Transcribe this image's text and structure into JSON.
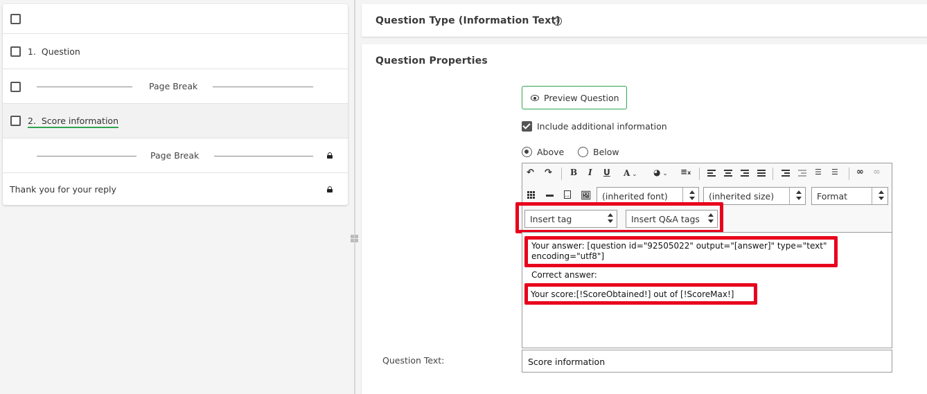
{
  "left_panel": {
    "rows": [
      {
        "type": "select-all",
        "label": ""
      },
      {
        "type": "question",
        "label": "1.  Question"
      },
      {
        "type": "page-break",
        "label": "Page Break"
      },
      {
        "type": "question",
        "label": "2.  Score information",
        "selected": true
      },
      {
        "type": "page-break",
        "label": "Page Break",
        "locked": true
      },
      {
        "type": "end",
        "label": "Thank you for your reply",
        "locked": true
      }
    ]
  },
  "header": {
    "question_type_title": "Question Type (Information Text)",
    "help_glyph": "?"
  },
  "properties": {
    "title": "Question Properties",
    "preview_button": "Preview Question",
    "include_additional_info": "Include additional information",
    "include_checked": true,
    "position_options": [
      "Above",
      "Below"
    ],
    "position_selected": "Above"
  },
  "editor": {
    "toolbar_icons": [
      "undo-icon",
      "redo-icon",
      "bold-icon",
      "italic-icon",
      "underline-icon",
      "text-color-icon",
      "background-color-icon",
      "clear-format-icon",
      "align-left-icon",
      "align-center-icon",
      "align-right-icon",
      "align-justify-icon",
      "indent-icon",
      "outdent-icon",
      "ordered-list-icon",
      "unordered-list-icon",
      "link-icon",
      "unlink-icon",
      "table-icon",
      "horizontal-rule-icon",
      "source-icon",
      "image-icon"
    ],
    "font_select": "(inherited font)",
    "size_select": "(inherited size)",
    "format_select": "Format",
    "insert_tag_select": "Insert tag",
    "insert_qa_tags_select": "Insert Q&A tags",
    "content": {
      "line1": "Your answer: [question id=\"92505022\" output=\"[answer]\" type=\"text\"",
      "line1b": "encoding=\"utf8\"]",
      "line2": "Correct answer:",
      "line3": "Your score:[!ScoreObtained!] out of [!ScoreMax!]"
    },
    "highlight_color": "#e8001c"
  },
  "question_text": {
    "label": "Question Text:",
    "value": "Score information"
  },
  "colors": {
    "accent_green": "#2ea44f",
    "highlight_red": "#e8001c"
  }
}
